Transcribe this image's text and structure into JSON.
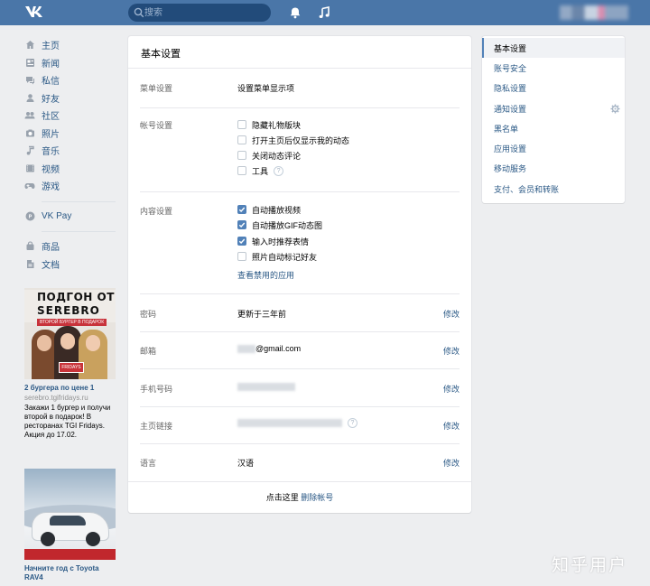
{
  "header": {
    "logo": "vk-logo-icon",
    "search_placeholder": "搜索",
    "bell_icon": "bell-icon",
    "music_icon": "music-icon",
    "bg_color": "#4a76a8"
  },
  "leftnav": {
    "items": [
      {
        "label": "主页",
        "icon": "home-icon"
      },
      {
        "label": "新闻",
        "icon": "news-icon"
      },
      {
        "label": "私信",
        "icon": "messages-icon"
      },
      {
        "label": "好友",
        "icon": "friends-icon"
      },
      {
        "label": "社区",
        "icon": "communities-icon"
      },
      {
        "label": "照片",
        "icon": "camera-icon"
      },
      {
        "label": "音乐",
        "icon": "music-note-icon"
      },
      {
        "label": "视频",
        "icon": "video-icon"
      },
      {
        "label": "游戏",
        "icon": "gamepad-icon"
      }
    ],
    "vkpay": {
      "label": "VK Pay",
      "icon": "vkpay-icon"
    },
    "extra": [
      {
        "label": "商品",
        "icon": "goods-icon"
      },
      {
        "label": "文档",
        "icon": "document-icon"
      }
    ]
  },
  "ads": [
    {
      "img_line1": "ПОДГОН ОТ",
      "img_line2": "SEREBRO",
      "img_line3": "ВТОРОЙ БУРГЕР В ПОДАРОК",
      "img_box": "FRIDAYS",
      "title": "2 бургера по цене 1",
      "link": "serebro.tgifridays.ru",
      "text": "Закажи 1 бургер и получи второй в подарок! В ресторанах TGI Fridays. Акция до 17.02."
    },
    {
      "title": "Начните год с Toyota RAV4"
    }
  ],
  "main": {
    "title": "基本设置",
    "menu_settings": {
      "label": "菜单设置",
      "link": "设置菜单显示项"
    },
    "account_settings": {
      "label": "帐号设置",
      "options": [
        {
          "label": "隐藏礼物版块",
          "checked": false
        },
        {
          "label": "打开主页后仅显示我的动态",
          "checked": false
        },
        {
          "label": "关闭动态评论",
          "checked": false
        },
        {
          "label": "工具",
          "checked": false,
          "help": "?"
        }
      ]
    },
    "content_settings": {
      "label": "内容设置",
      "options": [
        {
          "label": "自动播放视频",
          "checked": true
        },
        {
          "label": "自动播放GIF动态图",
          "checked": true
        },
        {
          "label": "输入时推荐表情",
          "checked": true
        },
        {
          "label": "照片自动标记好友",
          "checked": false
        }
      ],
      "link": "查看禁用的应用"
    },
    "password": {
      "label": "密码",
      "value": "更新于三年前",
      "action": "修改"
    },
    "email": {
      "label": "邮箱",
      "value": "@gmail.com",
      "action": "修改"
    },
    "phone": {
      "label": "手机号码",
      "action": "修改"
    },
    "homepage": {
      "label": "主页链接",
      "help": "?",
      "action": "修改"
    },
    "language": {
      "label": "语言",
      "value": "汉语",
      "action": "修改"
    },
    "footer": {
      "text": "点击这里 ",
      "link": "删除帐号"
    }
  },
  "rmenu": {
    "items": [
      {
        "label": "基本设置",
        "active": true
      },
      {
        "label": "账号安全",
        "active": false
      },
      {
        "label": "隐私设置",
        "active": false
      },
      {
        "label": "通知设置",
        "active": false
      },
      {
        "label": "黑名单",
        "active": false
      },
      {
        "label": "应用设置",
        "active": false
      },
      {
        "label": "移动服务",
        "active": false
      },
      {
        "label": "支付、会员和转账",
        "active": false
      }
    ],
    "gear_icon": "gear-icon"
  },
  "watermark": "知乎用户"
}
